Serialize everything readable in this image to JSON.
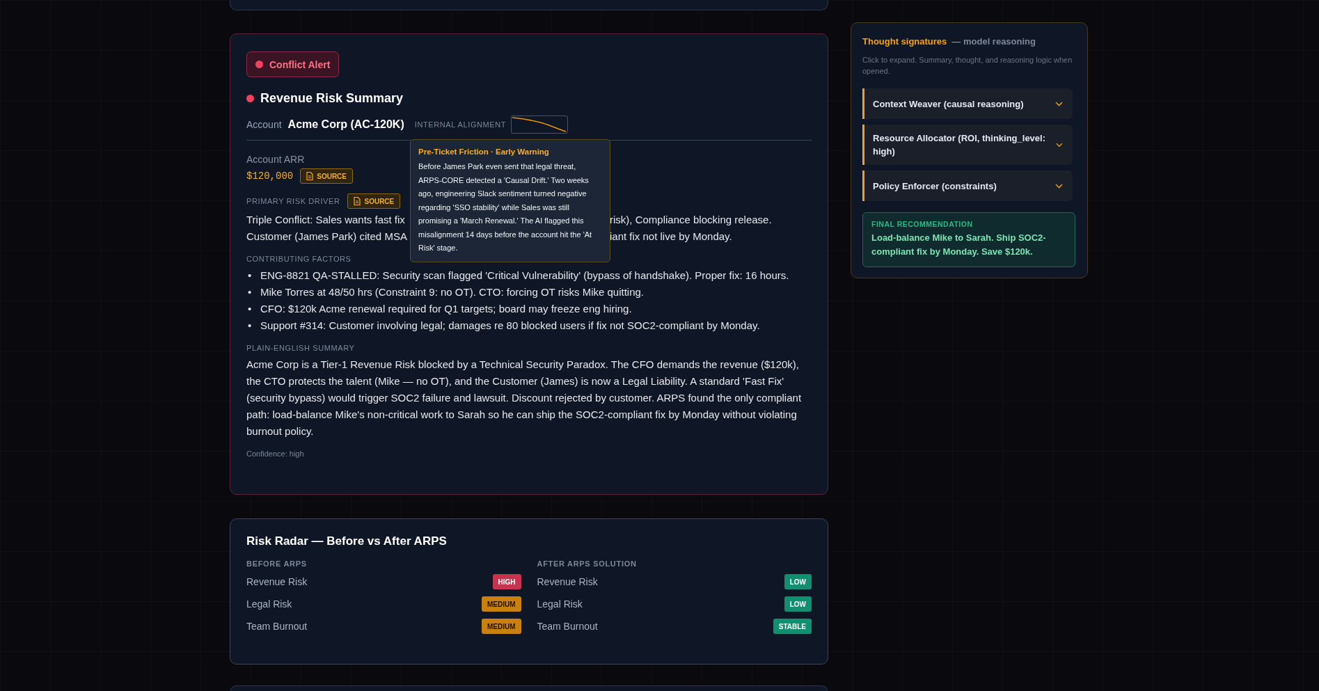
{
  "alert": {
    "label": "Conflict Alert",
    "color": "#f43f5e"
  },
  "summary": {
    "title": "Revenue Risk Summary",
    "color": "#f43f5e",
    "account_label": "Account",
    "account": "Acme Corp (AC-120K)",
    "alignment_label": "INTERNAL ALIGNMENT",
    "tooltip": {
      "title": "Pre-Ticket Friction · Early Warning",
      "text": "Before James Park even sent that legal threat, ARPS-CORE detected a 'Causal Drift.' Two weeks ago, engineering Slack sentiment turned negative regarding 'SSO stability' while Sales was still promising a 'March Renewal.' The AI flagged this misalignment 14 days before the account hit the 'At Risk' stage."
    },
    "arr_label": "Account ARR",
    "arr": "$120,000",
    "arr_source": "SOURCE",
    "driver_label": "PRIMARY RISK DRIVER",
    "driver_source": "SOURCE",
    "driver_lines": [
      {
        "left": "Triple Conflict: Sales wants fast fix",
        "right": "risk), Compliance blocking release."
      },
      {
        "left": "Customer (James Park) cited MSA",
        "right": "iant fix not live by Monday."
      }
    ],
    "factors_label": "CONTRIBUTING FACTORS",
    "factors": [
      {
        "marker": "•",
        "text": "ENG-8821 QA-STALLED: Security scan flagged 'Critical Vulnerability' (bypass of handshake). Proper fix: 16 hours."
      },
      {
        "marker": "•",
        "text": "Mike Torres at 48/50 hrs (Constraint 9: no OT). CTO: forcing OT risks Mike quitting."
      },
      {
        "marker": "•",
        "text": "CFO: $120k Acme renewal required for Q1 targets; board may freeze eng hiring."
      },
      {
        "marker": "•",
        "text": "Support #314: Customer involving legal; damages re 80 blocked users if fix not SOC2-compliant by Monday."
      }
    ],
    "summary_label": "PLAIN-ENGLISH SUMMARY",
    "summary_text": "Acme Corp is a Tier-1 Revenue Risk blocked by a Technical Security Paradox. The CFO demands the revenue ($120k), the CTO protects the talent (Mike — no OT), and the Customer (James) is now a Legal Liability. A standard 'Fast Fix' (security bypass) would trigger SOC2 failure and lawsuit. Discount rejected by customer. ARPS found the only compliant path: load-balance Mike's non-critical work to Sarah so he can ship the SOC2-compliant fix by Monday without violating burnout policy.",
    "confidence": "Confidence: high"
  },
  "radar": {
    "title": "Risk Radar — Before vs After ARPS",
    "columns": [
      {
        "heading": "BEFORE ARPS",
        "rows": [
          {
            "label": "Revenue Risk",
            "badge": "HIGH",
            "color": "#c8334f"
          },
          {
            "label": "Legal Risk",
            "badge": "MEDIUM",
            "color": "#c8800f"
          },
          {
            "label": "Team Burnout",
            "badge": "MEDIUM",
            "color": "#c8800f"
          }
        ]
      },
      {
        "heading": "AFTER ARPS SOLUTION",
        "rows": [
          {
            "label": "Revenue Risk",
            "badge": "LOW",
            "color": "#109070"
          },
          {
            "label": "Legal Risk",
            "badge": "LOW",
            "color": "#109070"
          },
          {
            "label": "Team Burnout",
            "badge": "STABLE",
            "color": "#109070"
          }
        ]
      }
    ]
  },
  "thoughts": {
    "title": "Thought signatures",
    "subtitle": "— model reasoning",
    "hint": "Click to expand. Summary, thought, and reasoning logic when opened.",
    "items": [
      {
        "label": "Context Weaver (causal reasoning)",
        "expanded": false
      },
      {
        "label": "Resource Allocator (ROI, thinking_level: high)",
        "expanded": false
      },
      {
        "label": "Policy Enforcer (constraints)",
        "expanded": false
      }
    ],
    "final": {
      "label": "FINAL RECOMMENDATION",
      "text": "Load-balance Mike to Sarah. Ship SOC2-compliant fix by Monday. Save $120k."
    }
  }
}
